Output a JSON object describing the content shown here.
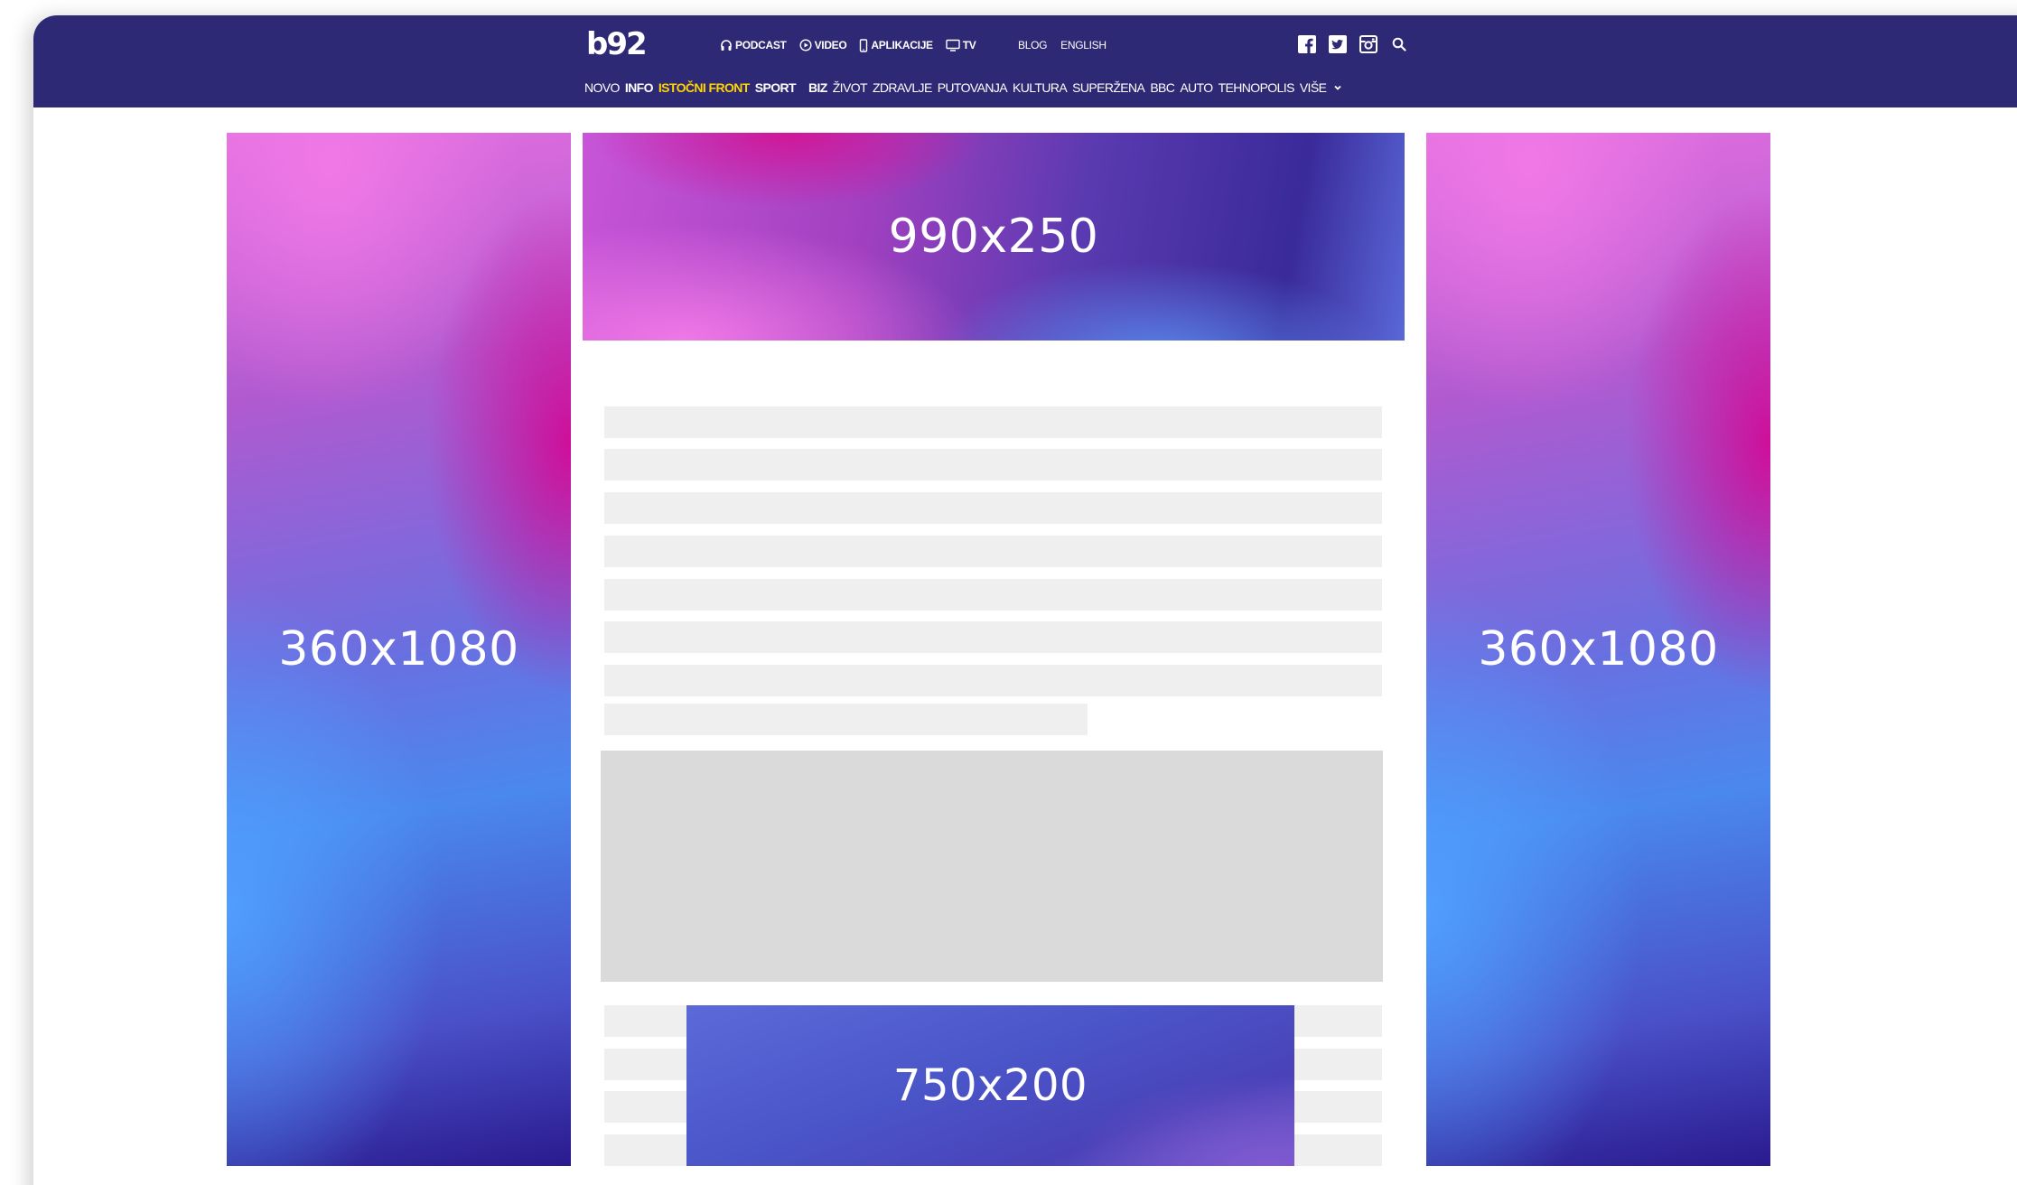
{
  "header": {
    "logo_text": "b92",
    "top_links": [
      {
        "label": "PODCAST",
        "icon": "headphones-icon"
      },
      {
        "label": "VIDEO",
        "icon": "play-circle-icon"
      },
      {
        "label": "APLIKACIJE",
        "icon": "phone-icon"
      },
      {
        "label": "TV",
        "icon": "tv-icon"
      }
    ],
    "secondary_links": [
      {
        "label": "BLOG"
      },
      {
        "label": "ENGLISH"
      }
    ],
    "social_icons": [
      "facebook-icon",
      "twitter-icon",
      "instagram-icon",
      "search-icon"
    ],
    "background_color": "#2e2974",
    "accent_color": "#ffd400"
  },
  "main_nav": {
    "items": [
      {
        "label": "NOVO",
        "style": "normal"
      },
      {
        "label": "INFO",
        "style": "bold"
      },
      {
        "label": "ISTOČNI FRONT",
        "style": "accent"
      },
      {
        "label": "SPORT",
        "style": "bold"
      },
      {
        "label": "BIZ",
        "style": "bold"
      },
      {
        "label": "ŽIVOT",
        "style": "normal"
      },
      {
        "label": "ZDRAVLJE",
        "style": "normal"
      },
      {
        "label": "PUTOVANJA",
        "style": "normal"
      },
      {
        "label": "KULTURA",
        "style": "normal"
      },
      {
        "label": "SUPERŽENA",
        "style": "normal"
      },
      {
        "label": "BBC",
        "style": "normal"
      },
      {
        "label": "AUTO",
        "style": "normal"
      },
      {
        "label": "TEHNOPOLIS",
        "style": "normal"
      },
      {
        "label": "VIŠE",
        "style": "normal"
      }
    ],
    "more_icon": "chevron-down-icon"
  },
  "ads": {
    "left": {
      "label": "360x1080"
    },
    "right": {
      "label": "360x1080"
    },
    "top": {
      "label": "990x250"
    },
    "inline": {
      "label": "750x200"
    }
  }
}
